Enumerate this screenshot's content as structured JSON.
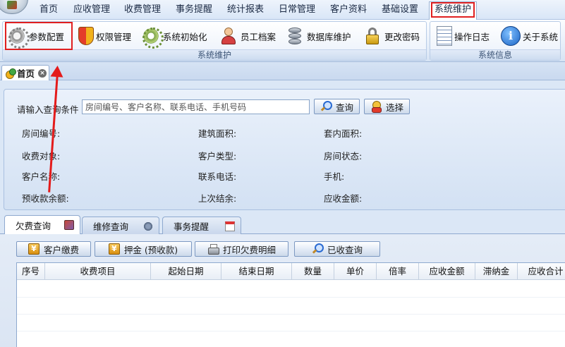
{
  "menu": {
    "items": [
      "首页",
      "应收管理",
      "收费管理",
      "事务提醒",
      "统计报表",
      "日常管理",
      "客户资料",
      "基础设置",
      "系统维护"
    ],
    "active_index": 8
  },
  "ribbon": {
    "group_maintenance": {
      "caption": "系统维护",
      "buttons": [
        "参数配置",
        "权限管理",
        "系统初始化",
        "员工档案",
        "数据库维护",
        "更改密码"
      ]
    },
    "group_info": {
      "caption": "系统信息",
      "buttons": [
        "操作日志",
        "关于系统"
      ]
    }
  },
  "doc_tab": {
    "label": "首页",
    "close": "×"
  },
  "query": {
    "prompt_label": "请输入查询条件",
    "input_placeholder": "房间编号、客户名称、联系电话、手机号码",
    "search_button": "查询",
    "select_button": "选择",
    "fields": [
      [
        "房间编号:",
        "建筑面积:",
        "套内面积:"
      ],
      [
        "收费对象:",
        "客户类型:",
        "房间状态:"
      ],
      [
        "客户名称:",
        "联系电话:",
        "手机:"
      ],
      [
        "预收款余额:",
        "上次结余:",
        "应收金额:"
      ]
    ]
  },
  "tabs": [
    "欠费查询",
    "维修查询",
    "事务提醒"
  ],
  "actions": {
    "customer_payment": "客户缴费",
    "deposit": "押金 (预收款)",
    "print_arrears": "打印欠费明细",
    "paid_query": "已收查询",
    "yen_glyph": "¥"
  },
  "table": {
    "columns": [
      "序号",
      "收费项目",
      "起始日期",
      "结束日期",
      "数量",
      "单价",
      "倍率",
      "应收金额",
      "滞纳金",
      "应收合计"
    ]
  },
  "icons": {
    "info_glyph": "i"
  },
  "colors": {
    "highlight": "#e02020",
    "accent_blue": "#1a63c4"
  }
}
